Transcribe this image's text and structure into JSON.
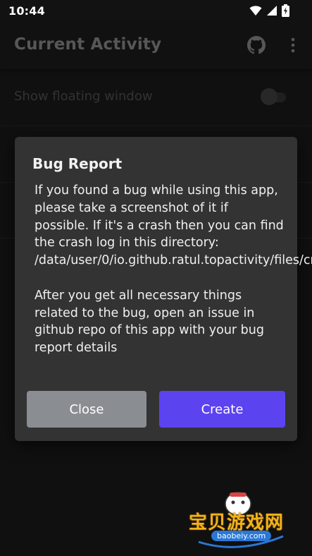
{
  "status_bar": {
    "time": "10:44",
    "icons": [
      "wifi-icon",
      "signal-icon",
      "battery-icon"
    ]
  },
  "app_bar": {
    "title": "Current Activity",
    "actions": [
      "github-icon",
      "more-vert-icon"
    ]
  },
  "settings": {
    "rows": [
      {
        "label": "Show floating window",
        "toggle_on": false
      }
    ]
  },
  "dialog": {
    "title": "Bug Report",
    "message_paragraph_1": "If you found a bug while using this app, please take a screenshot of it if possible. If it's a crash then you can find the crash log in this directory: /data/user/0/io.github.ratul.topactivity/files/crash.txt",
    "message_paragraph_2": "After you get all necessary things related to the bug, open an issue in github repo of this app with your bug report details",
    "close_label": "Close",
    "create_label": "Create"
  },
  "colors": {
    "primary_button": "#5b43f0",
    "secondary_button": "#8a8d92",
    "dialog_background": "#333333"
  },
  "watermark": {
    "text": "宝贝游戏网",
    "url": "baobeiy.com"
  }
}
